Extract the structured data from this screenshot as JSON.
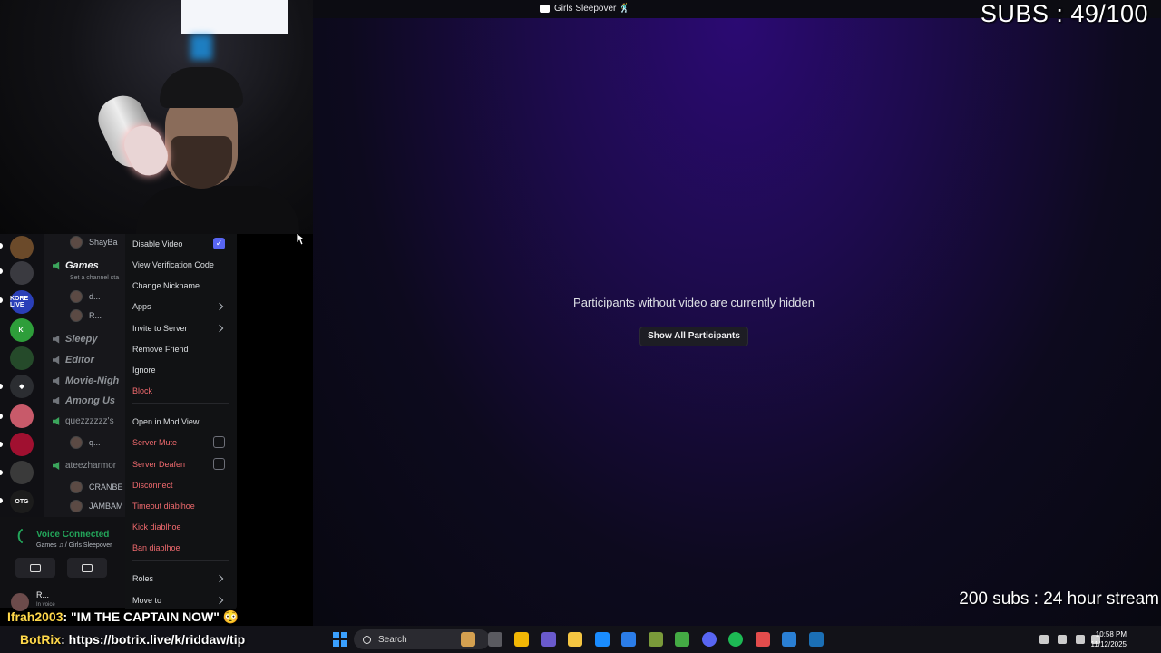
{
  "window": {
    "title": "Girls Sleepover 🕺"
  },
  "overlay": {
    "subs_counter": "SUBS : 49/100",
    "goal": "200 subs : 24 hour stream"
  },
  "stage": {
    "hidden_message": "Participants without video are currently hidden",
    "show_all_label": "Show All Participants"
  },
  "servers": [
    {
      "label": "",
      "color": "#6b4a2a"
    },
    {
      "label": "",
      "color": "#3a3a40"
    },
    {
      "label": "KORE LIVE",
      "color": "#2a3fb8"
    },
    {
      "label": "KI",
      "color": "#2e9e3a"
    },
    {
      "label": "",
      "color": "#254a2a"
    },
    {
      "label": "◆",
      "color": "#2b2d31"
    },
    {
      "label": "",
      "color": "#c85a6a"
    },
    {
      "label": "",
      "color": "#a01030"
    },
    {
      "label": "",
      "color": "#3a3a3a"
    },
    {
      "label": "OTG",
      "color": "#1c1c1c"
    }
  ],
  "channels": {
    "top_user": "ShayBa",
    "games": "Games",
    "games_sub": "Set a channel sta",
    "games_users": [
      "d...",
      "R..."
    ],
    "sleepy": "Sleepy",
    "editor": "Editor",
    "movie_night": "Movie-Nigh",
    "among_us": "Among Us",
    "quez": "quezzzzzz's",
    "quez_user": "q...",
    "ateez": "ateezharmor",
    "ateez_users": [
      "CRANBE",
      "JAMBAM"
    ]
  },
  "voice_panel": {
    "status": "Voice Connected",
    "location": "Games ♫ / Girls Sleepover",
    "user": "R...",
    "user_status": "In voice"
  },
  "context_menu": {
    "disable_video": "Disable Video",
    "view_verification": "View Verification Code",
    "change_nickname": "Change Nickname",
    "apps": "Apps",
    "invite": "Invite to Server",
    "remove_friend": "Remove Friend",
    "ignore": "Ignore",
    "block": "Block",
    "open_mod_view": "Open in Mod View",
    "server_mute": "Server Mute",
    "server_deafen": "Server Deafen",
    "disconnect": "Disconnect",
    "timeout": "Timeout diablhoe",
    "kick": "Kick diablhoe",
    "ban": "Ban diablhoe",
    "roles": "Roles",
    "move_to": "Move to"
  },
  "chat": {
    "user": "Ifrah2003",
    "message": ": \"IM THE CAPTAIN NOW\" 😳",
    "bot_user": "BotRix",
    "bot_message": ": https://botrix.live/k/riddaw/tip"
  },
  "taskbar": {
    "search_label": "Search",
    "time": "10:58 PM",
    "date": "11/12/2025",
    "icon_colors": [
      "#d4a050",
      "#5a5a60",
      "#f2b705",
      "#6a5acd",
      "#f4c542",
      "#1a8cff",
      "#2b7de9",
      "#7a9a3a",
      "#44aa44",
      "#5865f2",
      "#1db954",
      "#e34c4c",
      "#2a7fd4",
      "#1b6fb5"
    ]
  }
}
